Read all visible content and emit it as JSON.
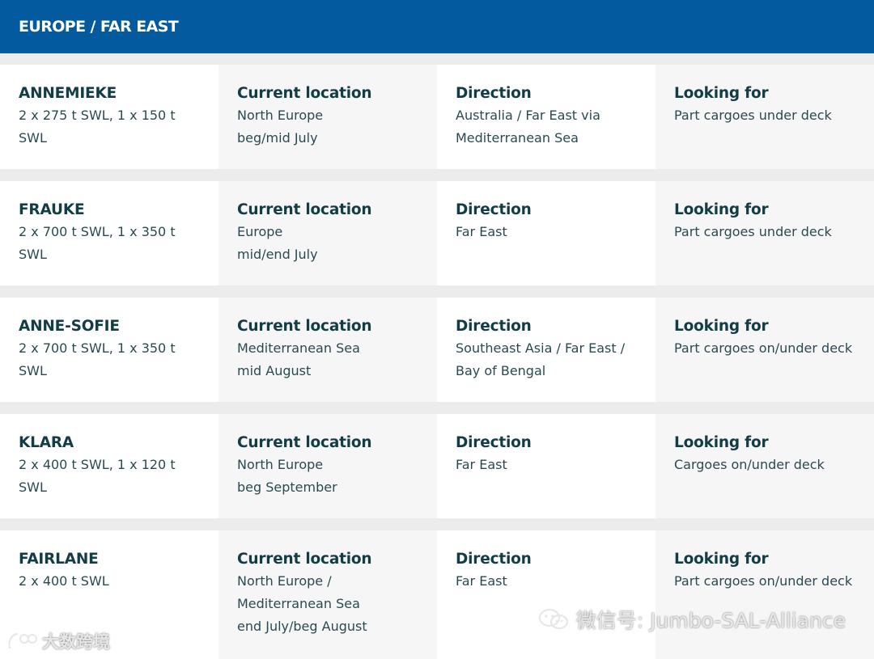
{
  "colors": {
    "header_bg": "#035a9e",
    "page_bg": "#ececec",
    "text_dark": "#123c46"
  },
  "header": {
    "title": "EUROPE / FAR EAST"
  },
  "rows": [
    {
      "vessel": "ANNEMIEKE",
      "capacity": [
        "2 x 275 t SWL, 1 x 150 t",
        "SWL"
      ],
      "location_heading": "Current location",
      "location": [
        "North Europe",
        "beg/mid July"
      ],
      "direction_heading": "Direction",
      "direction": [
        "Australia / Far East via",
        "Mediterranean Sea"
      ],
      "looking_heading": "Looking for",
      "looking": [
        "Part cargoes under deck"
      ]
    },
    {
      "vessel": "FRAUKE",
      "capacity": [
        "2 x 700 t SWL, 1 x 350 t",
        "SWL"
      ],
      "location_heading": "Current location",
      "location": [
        "Europe",
        "mid/end July"
      ],
      "direction_heading": "Direction",
      "direction": [
        "Far East"
      ],
      "looking_heading": "Looking for",
      "looking": [
        "Part cargoes under deck"
      ]
    },
    {
      "vessel": "ANNE-SOFIE",
      "capacity": [
        "2 x 700 t SWL, 1 x 350 t",
        "SWL"
      ],
      "location_heading": "Current location",
      "location": [
        "Mediterranean Sea",
        "mid August"
      ],
      "direction_heading": "Direction",
      "direction": [
        "Southeast Asia / Far East /",
        "Bay of Bengal"
      ],
      "looking_heading": "Looking for",
      "looking": [
        "Part cargoes on/under deck"
      ]
    },
    {
      "vessel": "KLARA",
      "capacity": [
        "2 x 400 t SWL, 1 x 120 t",
        "SWL"
      ],
      "location_heading": "Current location",
      "location": [
        "North Europe",
        "beg September"
      ],
      "direction_heading": "Direction",
      "direction": [
        "Far East"
      ],
      "looking_heading": "Looking for",
      "looking": [
        "Cargoes on/under deck"
      ]
    },
    {
      "vessel": "FAIRLANE",
      "capacity": [
        "2 x 400 t SWL"
      ],
      "location_heading": "Current location",
      "location": [
        "North Europe /",
        "Mediterranean Sea",
        "end July/beg August"
      ],
      "direction_heading": "Direction",
      "direction": [
        "Far East"
      ],
      "looking_heading": "Looking for",
      "looking": [
        "Part cargoes on/under deck"
      ]
    }
  ],
  "watermark": {
    "text": "微信号: Jumbo-SAL-Alliance",
    "icon": "wechat-icon",
    "left_text": "大数跨境",
    "left_icon": "bigdata-logo-icon"
  }
}
